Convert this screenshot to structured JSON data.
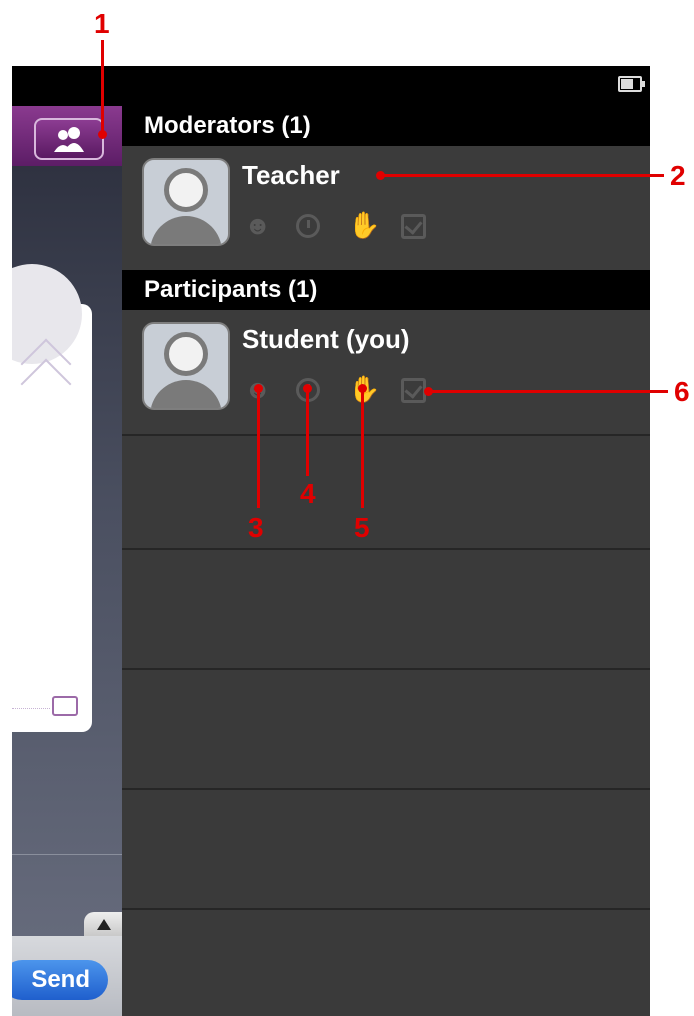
{
  "statusbar": {
    "battery_icon": "battery-icon"
  },
  "left_app": {
    "participants_button_icon": "people-icon",
    "send_label": "Send"
  },
  "panel": {
    "moderators_header": "Moderators (1)",
    "participants_header": "Participants (1)",
    "moderators": [
      {
        "name": "Teacher",
        "icons": [
          "smile-icon",
          "clock-icon",
          "hand-icon",
          "checkbox-icon"
        ]
      }
    ],
    "participants": [
      {
        "name": "Student (you)",
        "icons": [
          "smile-icon",
          "clock-icon",
          "hand-icon",
          "checkbox-icon"
        ]
      }
    ]
  },
  "callouts": [
    "1",
    "2",
    "3",
    "4",
    "5",
    "6"
  ],
  "colors": {
    "callout": "#e00000",
    "panel_bg": "#3a3a3a",
    "header_bg": "#000000",
    "accent_purple": "#5c1d66",
    "send_blue": "#2f74dd"
  }
}
